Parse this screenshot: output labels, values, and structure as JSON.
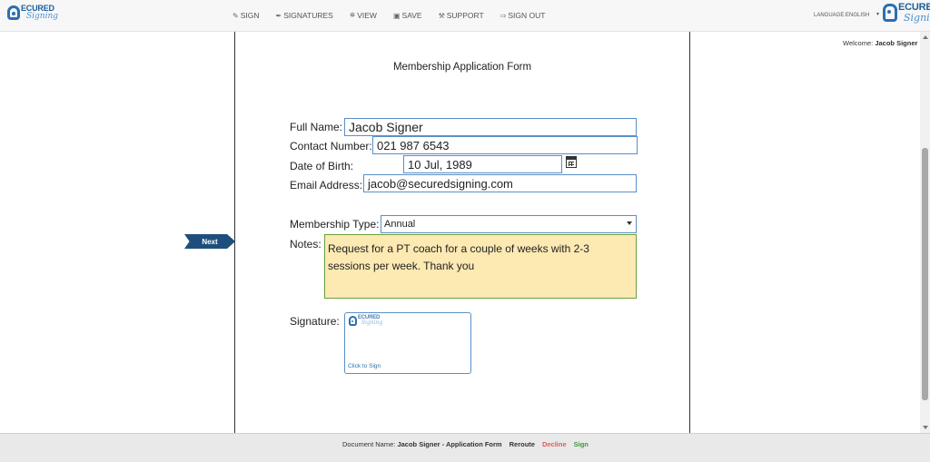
{
  "header": {
    "logo_word": "ECURED",
    "logo_script": "Signing",
    "nav": [
      {
        "label": "Sign",
        "icon": "pencil-square-icon",
        "glyph": "✎"
      },
      {
        "label": "Signatures",
        "icon": "pen-icon",
        "glyph": "✒"
      },
      {
        "label": "View",
        "icon": "binoculars-icon",
        "glyph": "⛯"
      },
      {
        "label": "Save",
        "icon": "save-icon",
        "glyph": "▣"
      },
      {
        "label": "Support",
        "icon": "wrench-icon",
        "glyph": "⚒"
      },
      {
        "label": "Sign Out",
        "icon": "sign-out-icon",
        "glyph": "⇨"
      }
    ],
    "language": "LANGUAGE:ENGLISH",
    "caret": "▾"
  },
  "welcome": {
    "prefix": "Welcome:",
    "name": "Jacob Signer"
  },
  "form": {
    "title": "Membership Application Form",
    "full_name_label": "Full Name:",
    "full_name_value": "Jacob Signer",
    "contact_label": "Contact Number:",
    "contact_value": "021 987 6543",
    "dob_label": "Date of Birth:",
    "dob_value": "10 Jul, 1989",
    "email_label": "Email Address:",
    "email_value": "jacob@securedsigning.com",
    "membership_label": "Membership Type:",
    "membership_value": "Annual",
    "notes_label": "Notes:",
    "notes_value": "Request for a PT coach for a couple of weeks with 2-3 sessions per week. Thank you",
    "signature_label": "Signature:",
    "click_to_sign": "Click to Sign"
  },
  "next_label": "Next",
  "footer": {
    "doc_name_label": "Document Name:",
    "doc_name_value": "Jacob Signer - Application Form",
    "reroute": "Reroute",
    "decline": "Decline",
    "sign": "Sign"
  },
  "colors": {
    "accent": "#1e4f7c",
    "field_border": "#5a8fc8",
    "notes_bg": "#fde9b2",
    "decline": "#e05a5a",
    "sign": "#3a9a3a"
  }
}
